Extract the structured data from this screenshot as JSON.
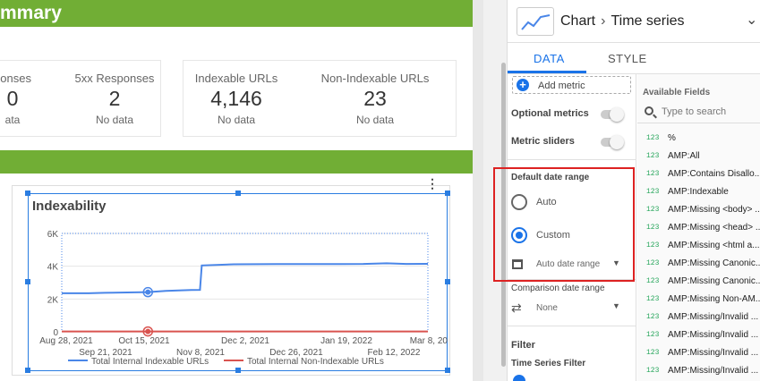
{
  "report": {
    "summary_title": "mmary",
    "metrics": [
      {
        "label": "ponses",
        "value": "0",
        "sub": "ata"
      },
      {
        "label": "5xx Responses",
        "value": "2",
        "sub": "No data"
      },
      {
        "label": "Indexable URLs",
        "value": "4,146",
        "sub": "No data"
      },
      {
        "label": "Non-Indexable URLs",
        "value": "23",
        "sub": "No data"
      }
    ],
    "chart_menu_icon": "more-vert-icon"
  },
  "chart_data": {
    "type": "line",
    "title": "Indexability",
    "ylim": [
      0,
      6000
    ],
    "y_ticks": [
      "6K",
      "4K",
      "2K",
      "0"
    ],
    "x_ticks_top": [
      "Aug 28, 2021",
      "Oct 15, 2021",
      "Dec 2, 2021",
      "Jan 19, 2022",
      "Mar 8, 20..."
    ],
    "x_ticks_bottom": [
      "Sep 21, 2021",
      "Nov 8, 2021",
      "Dec 26, 2021",
      "Feb 12, 2022"
    ],
    "x": [
      "2021-08-28",
      "2021-09-12",
      "2021-09-21",
      "2021-10-15",
      "2021-10-25",
      "2021-11-08",
      "2021-11-13",
      "2021-11-14",
      "2021-12-02",
      "2021-12-26",
      "2022-01-19",
      "2022-02-12",
      "2022-02-25",
      "2022-03-08",
      "2022-03-20"
    ],
    "series": [
      {
        "name": "Total Internal Indexable URLs",
        "color": "#4a86e8",
        "values": [
          2350,
          2350,
          2380,
          2420,
          2500,
          2550,
          2560,
          4050,
          4120,
          4130,
          4130,
          4140,
          4180,
          4140,
          4146
        ]
      },
      {
        "name": "Total Internal Non-Indexable URLs",
        "color": "#d9534f",
        "values": [
          20,
          20,
          20,
          21,
          21,
          21,
          22,
          22,
          22,
          23,
          23,
          23,
          23,
          23,
          23
        ]
      }
    ],
    "highlight_x": "2021-10-15",
    "grid": true,
    "legend": "bottom"
  },
  "panel": {
    "chart_label": "Chart",
    "type_label": "Time series",
    "tabs": [
      "DATA",
      "STYLE"
    ],
    "add_metric": "Add metric",
    "optional_metrics": "Optional metrics",
    "metric_sliders": "Metric sliders",
    "default_date_range": "Default date range",
    "auto": "Auto",
    "custom": "Custom",
    "auto_date_range": "Auto date range",
    "comparison_date_range": "Comparison date range",
    "comparison_value": "None",
    "filter": "Filter",
    "time_series_filter": "Time Series Filter",
    "available_fields": "Available Fields",
    "search_placeholder": "Type to search",
    "field_type": "123",
    "fields": [
      "%",
      "AMP:All",
      "AMP:Contains Disallo...",
      "AMP:Indexable",
      "AMP:Missing <body> ...",
      "AMP:Missing <head> ...",
      "AMP:Missing <html a...",
      "AMP:Missing Canonic...",
      "AMP:Missing Canonic...",
      "AMP:Missing Non-AM...",
      "AMP:Missing/Invalid ...",
      "AMP:Missing/Invalid ...",
      "AMP:Missing/Invalid ...",
      "AMP:Missing/Invalid ..."
    ]
  },
  "colors": {
    "accent": "#1a73e8",
    "banner": "#71ae35",
    "highlight_box": "#dd2222"
  }
}
